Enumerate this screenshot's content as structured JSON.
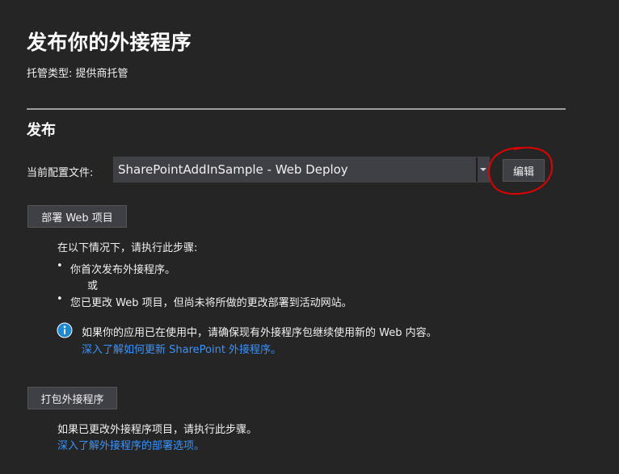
{
  "page": {
    "title": "发布你的外接程序",
    "hosting_type": "托管类型: 提供商托管"
  },
  "publish": {
    "section_title": "发布",
    "profile_label": "当前配置文件:",
    "profile_value": "SharePointAddInSample - Web Deploy",
    "edit_label": "编辑"
  },
  "deploy": {
    "button_label": "部署 Web 项目",
    "intro": "在以下情况下，请执行此步骤:",
    "bullets": [
      "你首次发布外接程序。",
      "您已更改 Web 项目，但尚未将所做的更改部署到活动网站。"
    ],
    "or_text": "或",
    "info_text": "如果你的应用已在使用中，请确保现有外接程序包继续使用新的 Web 内容。",
    "info_link": "深入了解如何更新 SharePoint 外接程序。"
  },
  "package": {
    "button_label": "打包外接程序",
    "description": "如果已更改外接程序项目，请执行此步骤。",
    "link": "深入了解外接程序的部署选项。"
  },
  "colors": {
    "background": "#252526",
    "link": "#3794ff",
    "annotation": "#e00000",
    "info_icon": "#1f8ad2"
  },
  "icons": {
    "info": "info-icon",
    "dropdown": "chevron-down-icon",
    "bullet": "bullet-icon"
  }
}
